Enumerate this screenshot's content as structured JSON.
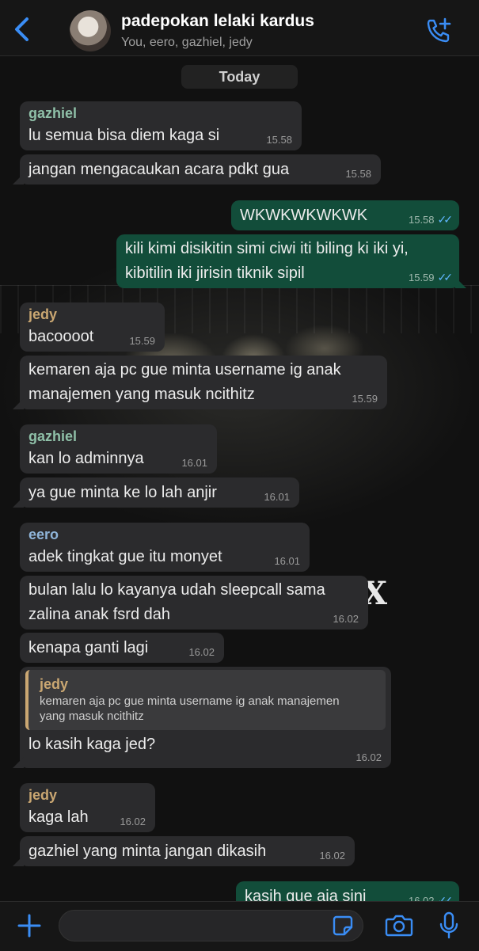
{
  "header": {
    "back_label": "Back",
    "title": "padepokan lelaki kardus",
    "members": "You, eero, gazhiel, jedy"
  },
  "date_chip": "Today",
  "messages": [
    {
      "sender": "gazhiel",
      "sender_color": "#8fc0a8",
      "text": "lu semua bisa diem kaga si",
      "time": "15.58"
    },
    {
      "text": "jangan mengacaukan acara pdkt gua",
      "time": "15.58"
    },
    {
      "text": "WKWKWKWKWK",
      "time": "15.58",
      "outgoing": true
    },
    {
      "text_lines": [
        "kili kimi disikitin simi ciwi iti biling ki iki yi,",
        "kibitilin iki jirisin tiknik sipil"
      ],
      "time": "15.59",
      "outgoing": true
    },
    {
      "sender": "jedy",
      "sender_color": "#caa772",
      "text": "bacoooot",
      "time": "15.59"
    },
    {
      "text_lines": [
        "kemaren aja pc gue minta username ig anak",
        "manajemen yang masuk ncithitz"
      ],
      "time": "15.59"
    },
    {
      "sender": "gazhiel",
      "sender_color": "#8fc0a8",
      "text": "kan lo adminnya",
      "time": "16.01"
    },
    {
      "text": "ya gue minta ke lo lah anjir",
      "time": "16.01"
    },
    {
      "sender": "eero",
      "sender_color": "#8fb4d8",
      "text": "adek tingkat gue itu monyet",
      "time": "16.01"
    },
    {
      "text_lines": [
        "bulan lalu lo kayanya udah sleepcall sama",
        "zalina anak fsrd dah"
      ],
      "time": "16.02"
    },
    {
      "text": "kenapa ganti lagi",
      "time": "16.02"
    },
    {
      "quote_sender": "jedy",
      "quote_lines": [
        "kemaren aja pc gue minta username ig anak manajemen",
        "yang masuk ncithitz"
      ],
      "text": "lo kasih kaga jed?",
      "time": "16.02"
    },
    {
      "sender": "jedy",
      "sender_color": "#caa772",
      "text": "kaga lah",
      "time": "16.02"
    },
    {
      "text": "gazhiel yang minta jangan dikasih",
      "time": "16.02"
    },
    {
      "text": "kasih gue aja sini",
      "time": "16.02",
      "outgoing": true
    }
  ],
  "composer": {
    "placeholder": ""
  },
  "colors": {
    "outgoing_bubble": "#124d3a",
    "incoming_bubble": "#2b2b2d",
    "accent": "#3a8df5",
    "read_ticks": "#5fb6ff"
  },
  "icons": [
    "chevron-left-icon",
    "phone-add-icon",
    "plus-icon",
    "sticker-icon",
    "camera-icon",
    "microphone-icon"
  ]
}
